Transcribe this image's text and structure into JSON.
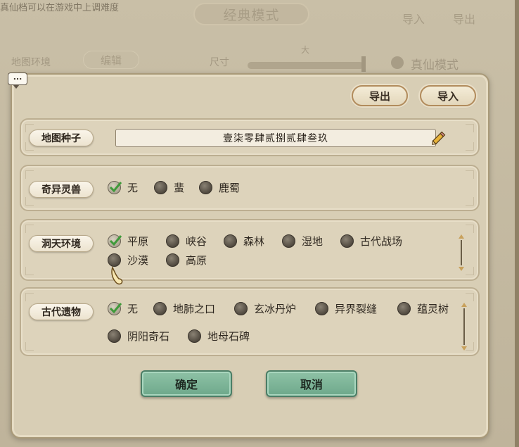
{
  "background": {
    "hint_text": "真仙档可以在游戏中上调难度",
    "mode_title": "经典模式",
    "top_import_label": "导入",
    "top_export_label": "导出",
    "map_env_label": "地图环境",
    "edit_label": "编辑",
    "size_label": "尺寸",
    "size_value": "大",
    "true_immortal_label": "真仙模式"
  },
  "chat_icon": "...",
  "dialog": {
    "export_label": "导出",
    "import_label": "导入",
    "seed": {
      "label": "地图种子",
      "value": "壹柒零肆贰捌贰肆叁玖"
    },
    "beast": {
      "label": "奇异灵兽",
      "options": [
        {
          "label": "无",
          "selected": true
        },
        {
          "label": "蜚",
          "selected": false
        },
        {
          "label": "鹿蜀",
          "selected": false
        }
      ]
    },
    "environment": {
      "label": "洞天环境",
      "options": [
        {
          "label": "平原",
          "selected": true
        },
        {
          "label": "峡谷",
          "selected": false
        },
        {
          "label": "森林",
          "selected": false
        },
        {
          "label": "湿地",
          "selected": false
        },
        {
          "label": "古代战场",
          "selected": false
        },
        {
          "label": "沙漠",
          "selected": false
        },
        {
          "label": "高原",
          "selected": false
        }
      ]
    },
    "relics": {
      "label": "古代遗物",
      "options": [
        {
          "label": "无",
          "selected": true
        },
        {
          "label": "地肺之口",
          "selected": false
        },
        {
          "label": "玄冰丹炉",
          "selected": false
        },
        {
          "label": "异界裂缝",
          "selected": false
        },
        {
          "label": "蕴灵树",
          "selected": false
        },
        {
          "label": "阴阳奇石",
          "selected": false
        },
        {
          "label": "地母石碑",
          "selected": false
        }
      ]
    },
    "confirm_label": "确定",
    "cancel_label": "取消"
  },
  "colors": {
    "panel": "#d8ceb5",
    "accent_green": "#7fb597",
    "check_green": "#3f9a3a"
  }
}
